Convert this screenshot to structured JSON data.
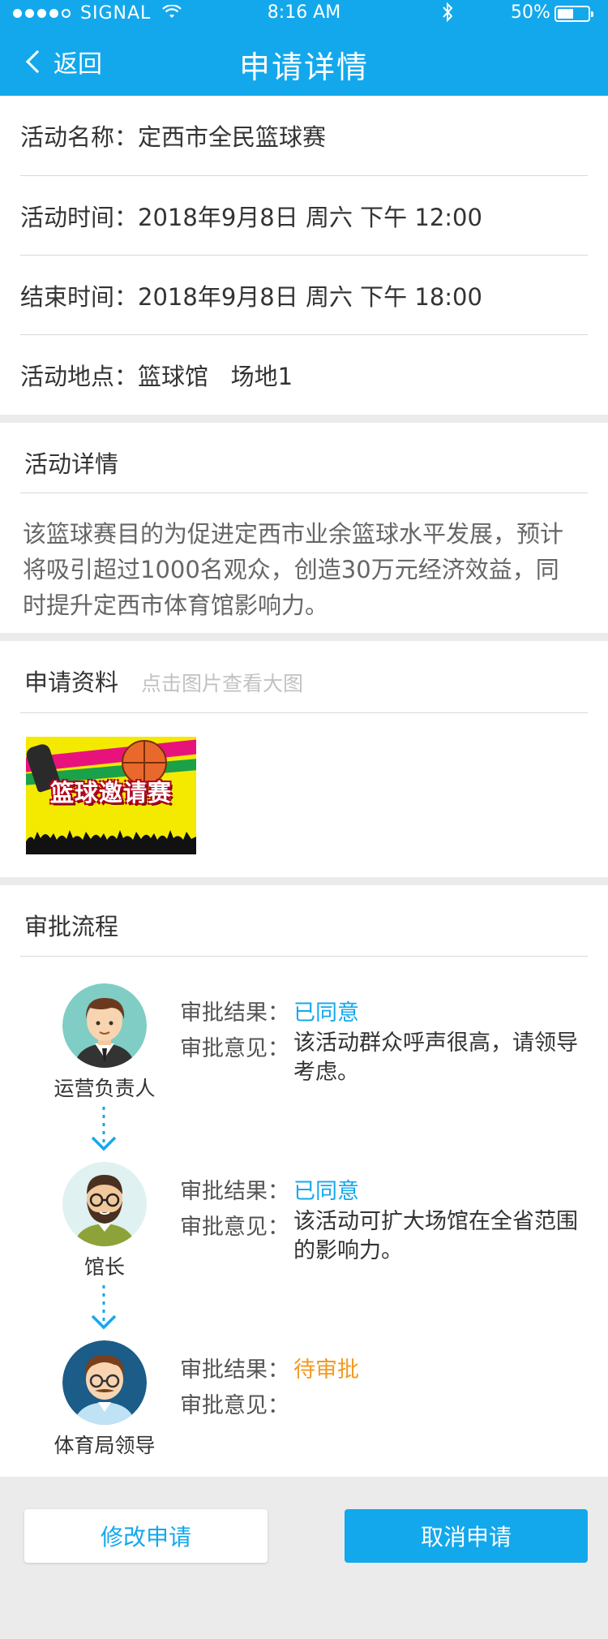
{
  "status_bar": {
    "carrier": "SIGNAL",
    "time": "8:16 AM",
    "battery": "50%"
  },
  "header": {
    "back_label": "返回",
    "title": "申请详情"
  },
  "info": {
    "rows": [
      {
        "label": "活动名称：",
        "value": "定西市全民篮球赛"
      },
      {
        "label": "活动时间：",
        "value": "2018年9月8日 周六 下午 12:00"
      },
      {
        "label": "结束时间：",
        "value": "2018年9月8日 周六 下午 18:00"
      },
      {
        "label": "活动地点：",
        "value": "篮球馆   场地1"
      }
    ]
  },
  "detail": {
    "title": "活动详情",
    "lines": [
      "该篮球赛目的为促进定西市业余篮球水平发展，预计",
      "将吸引超过1000名观众，创造30万元经济效益，同",
      "时提升定西市体育馆影响力。"
    ]
  },
  "materials": {
    "title": "申请资料",
    "hint": "点击图片查看大图",
    "image_text": "篮球邀请赛"
  },
  "approval": {
    "title": "审批流程",
    "result_label": "审批结果：",
    "opinion_label": "审批意见：",
    "steps": [
      {
        "role": "运营负责人",
        "result": "已同意",
        "status": "approved",
        "opinion_lines": [
          "该活动群众呼声很高，请领导",
          "考虑。"
        ]
      },
      {
        "role": "馆长",
        "result": "已同意",
        "status": "approved",
        "opinion_lines": [
          "该活动可扩大场馆在全省范围",
          "的影响力。"
        ]
      },
      {
        "role": "体育局领导",
        "result": "待审批",
        "status": "pending",
        "opinion_lines": []
      }
    ]
  },
  "actions": {
    "modify_label": "修改申请",
    "cancel_label": "取消申请"
  },
  "colors": {
    "primary": "#13a8ec",
    "pending": "#f39a21",
    "background": "#ebebeb"
  }
}
